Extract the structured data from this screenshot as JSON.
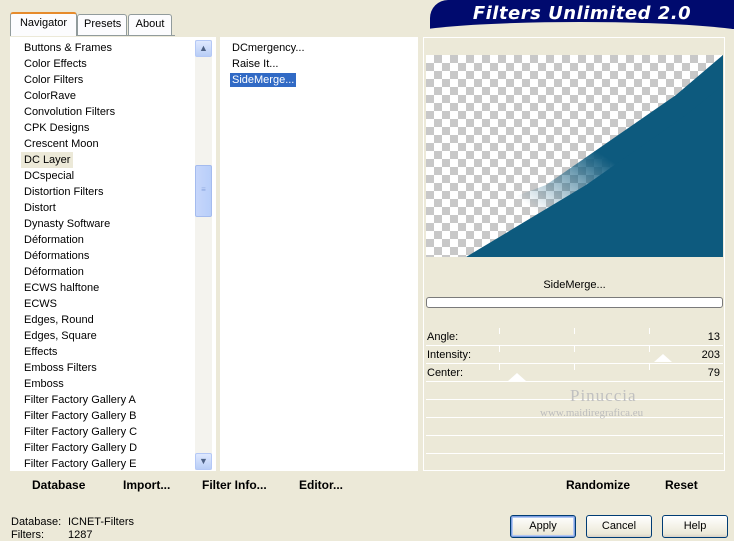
{
  "tabs": [
    {
      "label": "Navigator",
      "active": true
    },
    {
      "label": "Presets",
      "active": false
    },
    {
      "label": "About",
      "active": false
    }
  ],
  "app_title": "Filters Unlimited 2.0",
  "categories": [
    "Buttons & Frames",
    "Color Effects",
    "Color Filters",
    "ColorRave",
    "Convolution Filters",
    "CPK Designs",
    "Crescent Moon",
    "DC Layer",
    "DCspecial",
    "Distortion Filters",
    "Distort",
    "Dynasty Software",
    "Déformation",
    "Déformations",
    "Déformation",
    "ECWS halftone",
    "ECWS",
    "Edges, Round",
    "Edges, Square",
    "Effects",
    "Emboss Filters",
    "Emboss",
    "Filter Factory Gallery A",
    "Filter Factory Gallery B",
    "Filter Factory Gallery C",
    "Filter Factory Gallery D",
    "Filter Factory Gallery E"
  ],
  "selected_category": "DC Layer",
  "filters": [
    "DCmergency...",
    "Raise It...",
    "SideMerge..."
  ],
  "selected_filter": "SideMerge...",
  "preview_filter_name": "SideMerge...",
  "params": [
    {
      "label": "Angle:",
      "value": "13",
      "level": 13
    },
    {
      "label": "Intensity:",
      "value": "203",
      "level": 203
    },
    {
      "label": "Center:",
      "value": "79",
      "level": 79
    }
  ],
  "watermark": {
    "line1": "Pinuccia",
    "line2": "www.maidiregrafica.eu"
  },
  "toolbar": {
    "database": "Database",
    "import": "Import...",
    "filter_info": "Filter Info...",
    "editor": "Editor...",
    "randomize": "Randomize",
    "reset": "Reset"
  },
  "status": {
    "database_label": "Database:",
    "database_value": "ICNET-Filters",
    "filters_label": "Filters:",
    "filters_value": "1287"
  },
  "buttons": {
    "apply": "Apply",
    "cancel": "Cancel",
    "help": "Help"
  },
  "colors": {
    "accent_selection": "#316ac5",
    "banner": "#000a6e",
    "preview_fill": "#0d5a7e"
  }
}
